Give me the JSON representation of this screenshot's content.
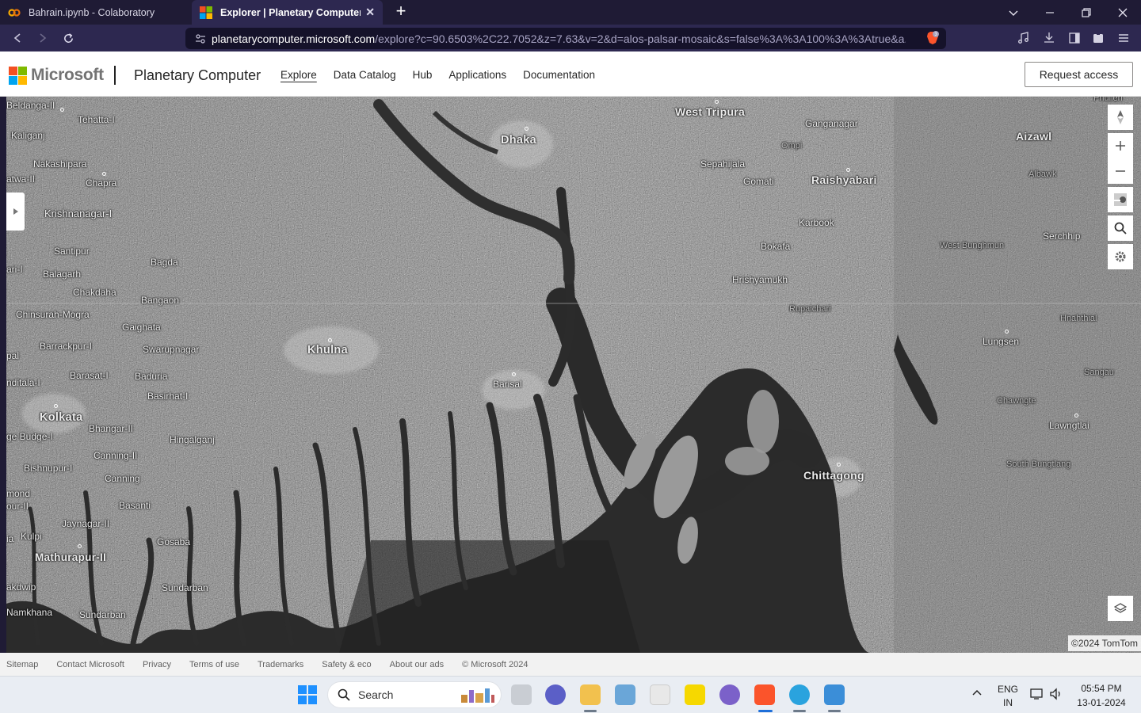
{
  "browser": {
    "tabs": [
      {
        "title": "Bahrain.ipynb - Colaboratory",
        "icon": "colab-icon",
        "active": false
      },
      {
        "title": "Explorer | Planetary Computer",
        "icon": "microsoft-icon",
        "active": true
      }
    ],
    "url_host": "planetarycomputer.microsoft.com",
    "url_path": "/explore?c=90.6503%2C22.7052&z=7.63&v=2&d=alos-palsar-mosaic&s=false%3A%3A100%3A%3Atrue&a...",
    "brave_badge": "3"
  },
  "header": {
    "brand": "Microsoft",
    "product": "Planetary Computer",
    "nav": [
      {
        "label": "Explore",
        "active": true
      },
      {
        "label": "Data Catalog",
        "active": false
      },
      {
        "label": "Hub",
        "active": false
      },
      {
        "label": "Applications",
        "active": false
      },
      {
        "label": "Documentation",
        "active": false
      }
    ],
    "request_access": "Request access"
  },
  "map": {
    "labels": [
      "Beldanga-II",
      "Tehatta-I",
      "Kaliganj",
      "Nakashipara",
      "Chapra",
      "atwa-II",
      "Krishnanagar-I",
      "Santipur",
      "Bagda",
      "ari-I",
      "Balagarh",
      "Chakdaha",
      "Bangaon",
      "Chinsurah-Mogra",
      "Gaighata",
      "Barrackpur-I",
      "Swarupnagar",
      "Khulna",
      "pal",
      "Barasat-I",
      "Baduria",
      "nditala-I",
      "Basirhat-I",
      "Kolkata",
      "ge Budge-I",
      "Bhangar-II",
      "Hingalganj",
      "Canning-II",
      "Bishnupur-I",
      "Canning",
      "mond",
      "our-II",
      "Basanti",
      "Jaynagar-II",
      "Kulpi",
      "ia",
      "Gosaba",
      "Mathurapur-II",
      "akdwip",
      "Sundarban",
      "Namkhana",
      "Sundarban",
      "Dhaka",
      "Barisal",
      "West Tripura",
      "Ganganagar",
      "Ompi",
      "Sepahijala",
      "Gomati",
      "Raishyabari",
      "Karbook",
      "Bokafa",
      "Hrishyamukh",
      "Rupaichari",
      "Chittagong",
      "Aizawl",
      "Albawk",
      "Serchhip",
      "West Bunghmun",
      "Hnahthial",
      "Lungsen",
      "Sangau",
      "Chawngte",
      "Lawngtlai",
      "South Bungtlang",
      "Phullen"
    ],
    "attribution": "©2024 TomTom"
  },
  "footer": {
    "links": [
      "Sitemap",
      "Contact Microsoft",
      "Privacy",
      "Terms of use",
      "Trademarks",
      "Safety & eco",
      "About our ads",
      "© Microsoft 2024"
    ]
  },
  "taskbar": {
    "search_label": "Search",
    "lang_line1": "ENG",
    "lang_line2": "IN",
    "time": "05:54 PM",
    "date": "13-01-2024"
  }
}
